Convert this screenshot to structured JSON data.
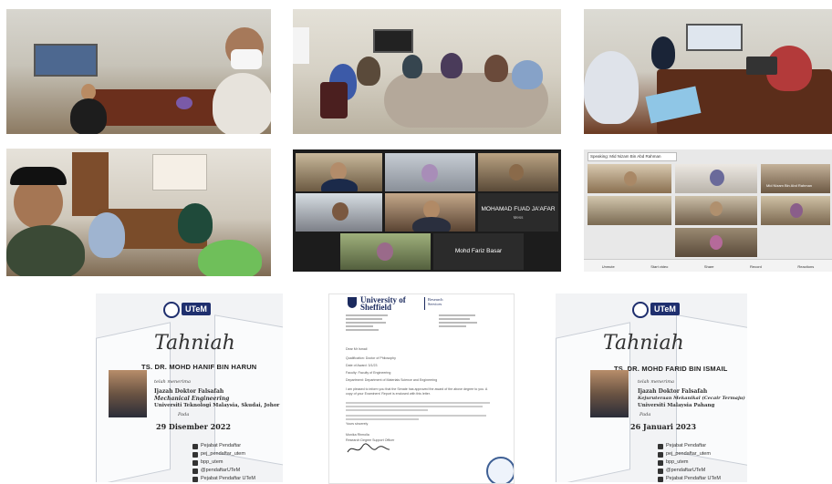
{
  "video_call_1": {
    "participants": [
      "MOHAMAD FUAD JA'AFAR",
      "Mohd Fariz Basar"
    ],
    "participant_caption": "Mess"
  },
  "video_call_2": {
    "speaking_banner": "Speaking: Mid Nizam Bin Abd Rahman",
    "tile_names": [
      "Mid Nizam Bin Abd Rahman"
    ],
    "toolbar": [
      "Unmute",
      "Start video",
      "Share",
      "Record",
      "Reactions"
    ]
  },
  "certificate_1": {
    "logo": "UTeM",
    "title": "Tahniah",
    "name": "TS. DR. MOHD HANIF BIN HARUN",
    "awarded_text": "telah menerima",
    "degree_line1": "Ijazah Doktor Falsafah",
    "degree_line2": "Mechanical Engineering",
    "university": "Universiti Teknologi Malaysia, Skudai, Johor",
    "pada": "Pada",
    "date": "29 Disember 2022",
    "social": [
      "Pejabat Pendaftar",
      "pej_pendaftar_utem",
      "bpp_utem",
      "@pendaftarUTeM",
      "Pejabat Pendaftar UTeM"
    ]
  },
  "certificate_2": {
    "university": "University of Sheffield",
    "tag": "Research Services",
    "salutation": "Dear Mr Ismail",
    "qualification": "Qualification: Doctor of Philosophy",
    "date_of_award": "Date of Award: 3/1/23",
    "faculty": "Faculty: Faculty of Engineering",
    "department": "Department: Department of Materials Science and Engineering",
    "body": "I am pleased to inform you that the Senate has approved the award of the above degree to you. A copy of your Examiners' Report is enclosed with this letter.",
    "closing": "Yours sincerely",
    "signatory": "Monika Rhmolla",
    "signatory_title": "Research Degree Support Officer"
  },
  "certificate_3": {
    "logo": "UTeM",
    "title": "Tahniah",
    "name": "TS. DR. MOHD FARID BIN ISMAIL",
    "awarded_text": "telah menerima",
    "degree_line1": "Ijazah Doktor Falsafah",
    "degree_line2": "Kejuruteraan Mekanikal (Cecair Termaju)",
    "university": "Universiti Malaysia Pahang",
    "pada": "Pada",
    "date": "26 Januari 2023",
    "social": [
      "Pejabat Pendaftar",
      "pej_pendaftar_utem",
      "bpp_utem",
      "@pendaftarUTeM",
      "Pejabat Pendaftar UTeM"
    ]
  }
}
